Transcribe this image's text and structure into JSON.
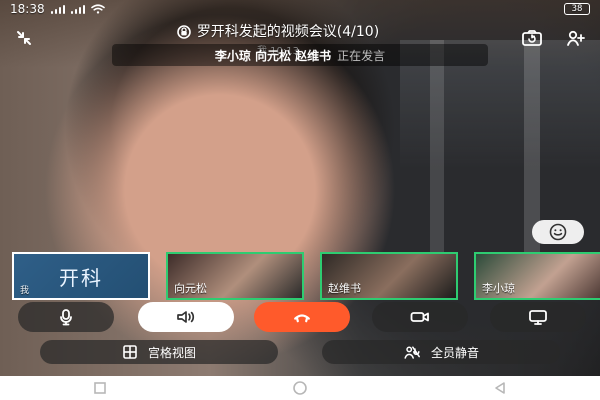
{
  "status_bar": {
    "time": "18:38",
    "battery": "38"
  },
  "meeting": {
    "title": "罗开科发起的视频会议(4/10)",
    "time": "我 10:13"
  },
  "speaking_banner": {
    "names": "李小琼 向元松 赵维书",
    "status": "正在发言"
  },
  "participants": [
    {
      "avatar_text": "开科",
      "name": "我"
    },
    {
      "name": "向元松"
    },
    {
      "name": "赵维书"
    },
    {
      "name": "李小琼"
    }
  ],
  "actions": {
    "grid_view_label": "宫格视图",
    "mute_all_label": "全员静音"
  },
  "colors": {
    "hangup": "#ff5a2b",
    "active_border": "#2ecc71",
    "self_border": "#ffffff"
  },
  "icons": {
    "shrink": "shrink-icon",
    "camera_switch": "camera-switch-icon",
    "add_member": "add-member-icon",
    "meeting_lock": "meeting-lock-icon",
    "emoji": "emoji-icon",
    "microphone": "microphone-icon",
    "speaker": "speaker-icon",
    "hangup": "hangup-icon",
    "camera": "camera-icon",
    "screen_share": "screen-share-icon",
    "grid": "grid-icon",
    "mute_all": "mute-all-icon",
    "nav_back": "back-icon",
    "nav_home": "home-icon",
    "nav_recents": "recents-icon"
  }
}
